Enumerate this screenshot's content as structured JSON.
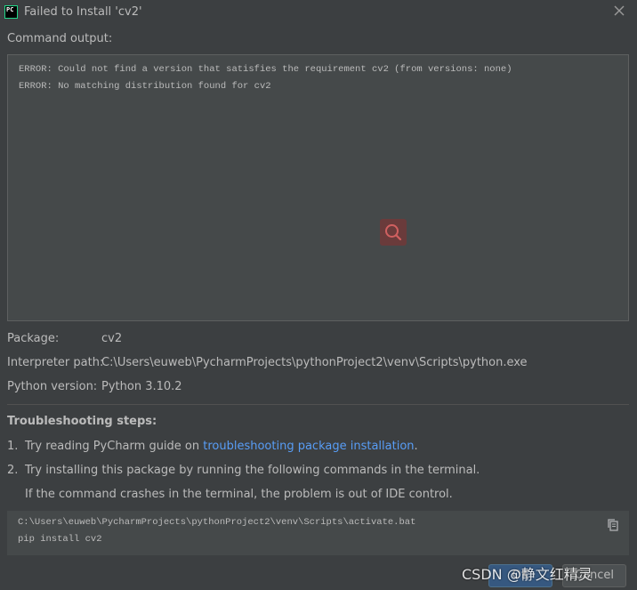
{
  "window": {
    "title": "Failed to Install 'cv2'",
    "app_icon_text": "PC"
  },
  "command_output": {
    "label": "Command output:",
    "lines": [
      "ERROR: Could not find a version that satisfies the requirement cv2 (from versions: none)",
      "ERROR: No matching distribution found for cv2"
    ]
  },
  "details": {
    "package_label": "Package:",
    "package_value": "cv2",
    "interpreter_label": "Interpreter path:",
    "interpreter_value": "C:\\Users\\euweb\\PycharmProjects\\pythonProject2\\venv\\Scripts\\python.exe",
    "python_version_label": "Python version:",
    "python_version_value": "Python 3.10.2"
  },
  "troubleshooting": {
    "heading": "Troubleshooting steps:",
    "step1_num": "1.",
    "step1_prefix": "Try reading PyCharm guide on ",
    "step1_link": "troubleshooting package installation",
    "step1_suffix": ".",
    "step2_num": "2.",
    "step2_text": "Try installing this package by running the following commands in the terminal.",
    "step2_note": "If the command crashes in the terminal, the problem is out of IDE control."
  },
  "commands": {
    "lines": [
      "C:\\Users\\euweb\\PycharmProjects\\pythonProject2\\venv\\Scripts\\activate.bat",
      "pip install cv2"
    ]
  },
  "buttons": {
    "ok": "OK",
    "cancel": "Cancel"
  },
  "watermark": "CSDN @静文红精灵",
  "icons": {
    "close": "close-icon",
    "search": "search-icon",
    "copy": "copy-icon"
  },
  "colors": {
    "background": "#3c3f41",
    "panel": "#45494a",
    "link": "#589df6",
    "text": "#bbbbbb",
    "search_highlight": "#6a3b3b"
  }
}
